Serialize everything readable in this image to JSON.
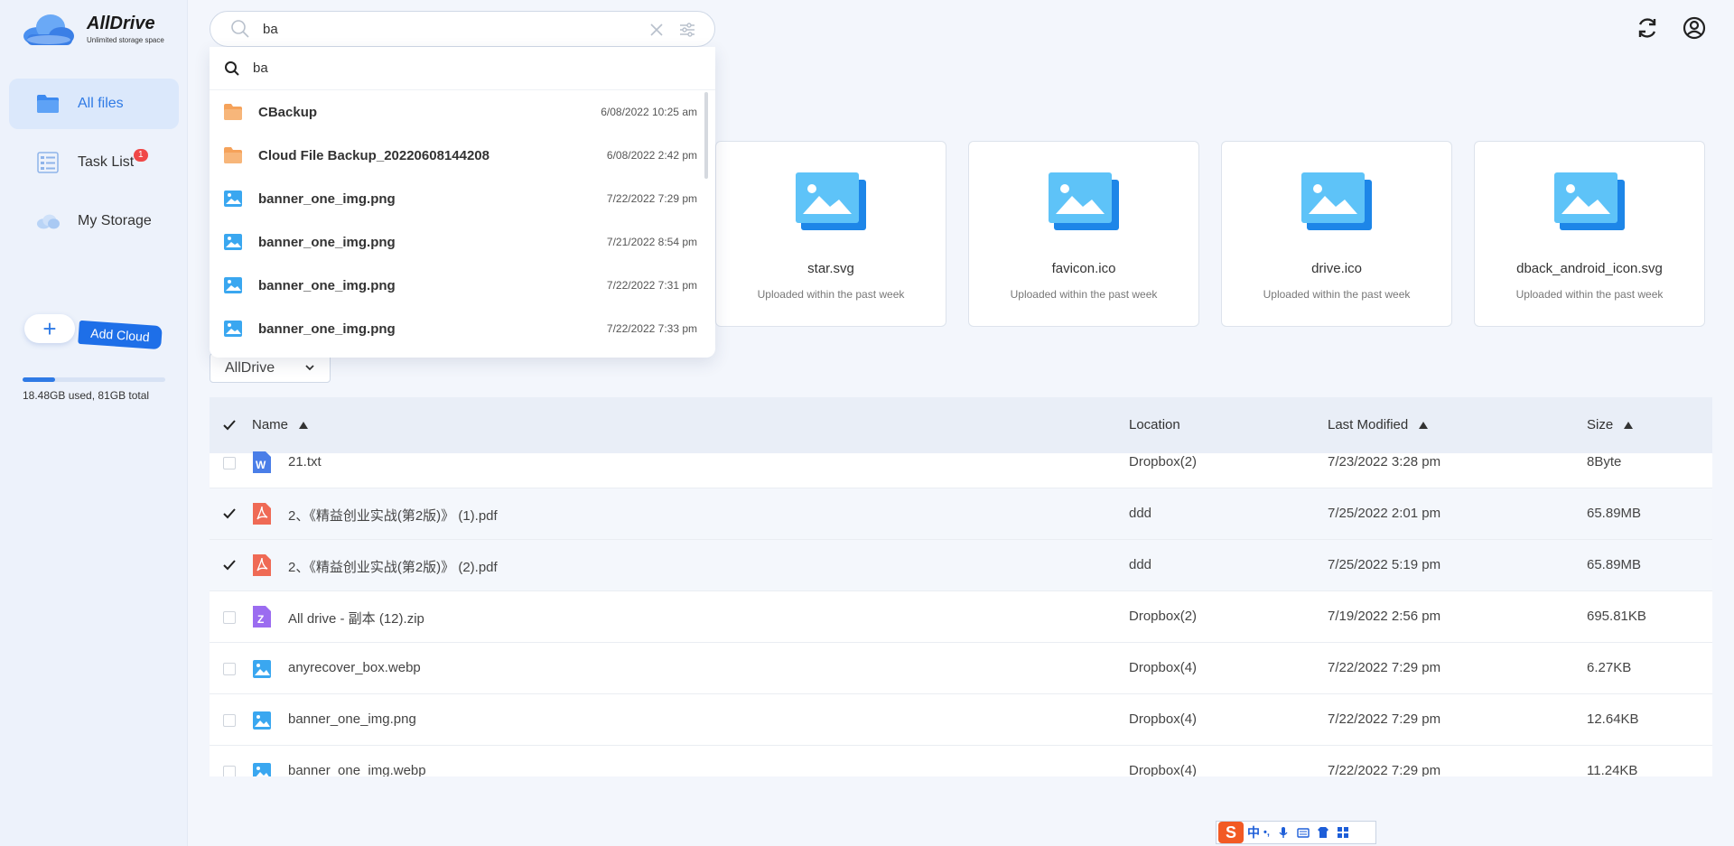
{
  "app": {
    "name": "AllDrive",
    "tagline": "Unlimited storage space"
  },
  "sidebar": {
    "items": [
      {
        "label": "All files",
        "icon": "folder-icon",
        "active": true
      },
      {
        "label": "Task List",
        "icon": "task-list-icon",
        "badge": "1"
      },
      {
        "label": "My Storage",
        "icon": "cloud-icon"
      }
    ],
    "add_cloud_label": "Add Cloud",
    "storage_text": "18.48GB used, 81GB total",
    "storage_used_fraction": 0.228
  },
  "search": {
    "value": "ba",
    "query_echo": "ba",
    "results": [
      {
        "name": "CBackup",
        "date": "6/08/2022 10:25 am",
        "icon": "folder-icon"
      },
      {
        "name": "Cloud File Backup_20220608144208",
        "date": "6/08/2022 2:42 pm",
        "icon": "folder-icon"
      },
      {
        "name": "banner_one_img.png",
        "date": "7/22/2022 7:29 pm",
        "icon": "image-icon"
      },
      {
        "name": "banner_one_img.png",
        "date": "7/21/2022 8:54 pm",
        "icon": "image-icon"
      },
      {
        "name": "banner_one_img.png",
        "date": "7/22/2022 7:31 pm",
        "icon": "image-icon"
      },
      {
        "name": "banner_one_img.png",
        "date": "7/22/2022 7:33 pm",
        "icon": "image-icon"
      }
    ]
  },
  "recent": [
    {
      "name": "star.svg",
      "sub": "Uploaded within the past week"
    },
    {
      "name": "favicon.ico",
      "sub": "Uploaded within the past week"
    },
    {
      "name": "drive.ico",
      "sub": "Uploaded within the past week"
    },
    {
      "name": "dback_android_icon.svg",
      "sub": "Uploaded within the past week"
    }
  ],
  "location_filter": "AllDrive",
  "table": {
    "headers": {
      "name": "Name",
      "location": "Location",
      "modified": "Last Modified",
      "size": "Size"
    },
    "rows": [
      {
        "name": "21.txt",
        "location": "Dropbox(2)",
        "modified": "7/23/2022 3:28 pm",
        "size": "8Byte",
        "type": "word",
        "checked": false
      },
      {
        "name": "2、《精益创业实战(第2版)》 (1).pdf",
        "location": "ddd",
        "modified": "7/25/2022 2:01 pm",
        "size": "65.89MB",
        "type": "pdf",
        "checked": true
      },
      {
        "name": "2、《精益创业实战(第2版)》 (2).pdf",
        "location": "ddd",
        "modified": "7/25/2022 5:19 pm",
        "size": "65.89MB",
        "type": "pdf",
        "checked": true
      },
      {
        "name": "All drive - 副本 (12).zip",
        "location": "Dropbox(2)",
        "modified": "7/19/2022 2:56 pm",
        "size": "695.81KB",
        "type": "zip",
        "checked": false
      },
      {
        "name": "anyrecover_box.webp",
        "location": "Dropbox(4)",
        "modified": "7/22/2022 7:29 pm",
        "size": "6.27KB",
        "type": "image",
        "checked": false
      },
      {
        "name": "banner_one_img.png",
        "location": "Dropbox(4)",
        "modified": "7/22/2022 7:29 pm",
        "size": "12.64KB",
        "type": "image",
        "checked": false
      },
      {
        "name": "banner_one_img.webp",
        "location": "Dropbox(4)",
        "modified": "7/22/2022 7:29 pm",
        "size": "11.24KB",
        "type": "image",
        "checked": false
      }
    ]
  },
  "ime": {
    "logo": "S",
    "lang": "中",
    "punct": "•,"
  },
  "colors": {
    "accent": "#2f7ae5",
    "badge": "#f04848",
    "folder": "#f5a25a",
    "image_icon": "#3aa7f0",
    "pdf": "#ef6a55",
    "zip": "#9b6cf0",
    "word": "#4a7ee8"
  }
}
